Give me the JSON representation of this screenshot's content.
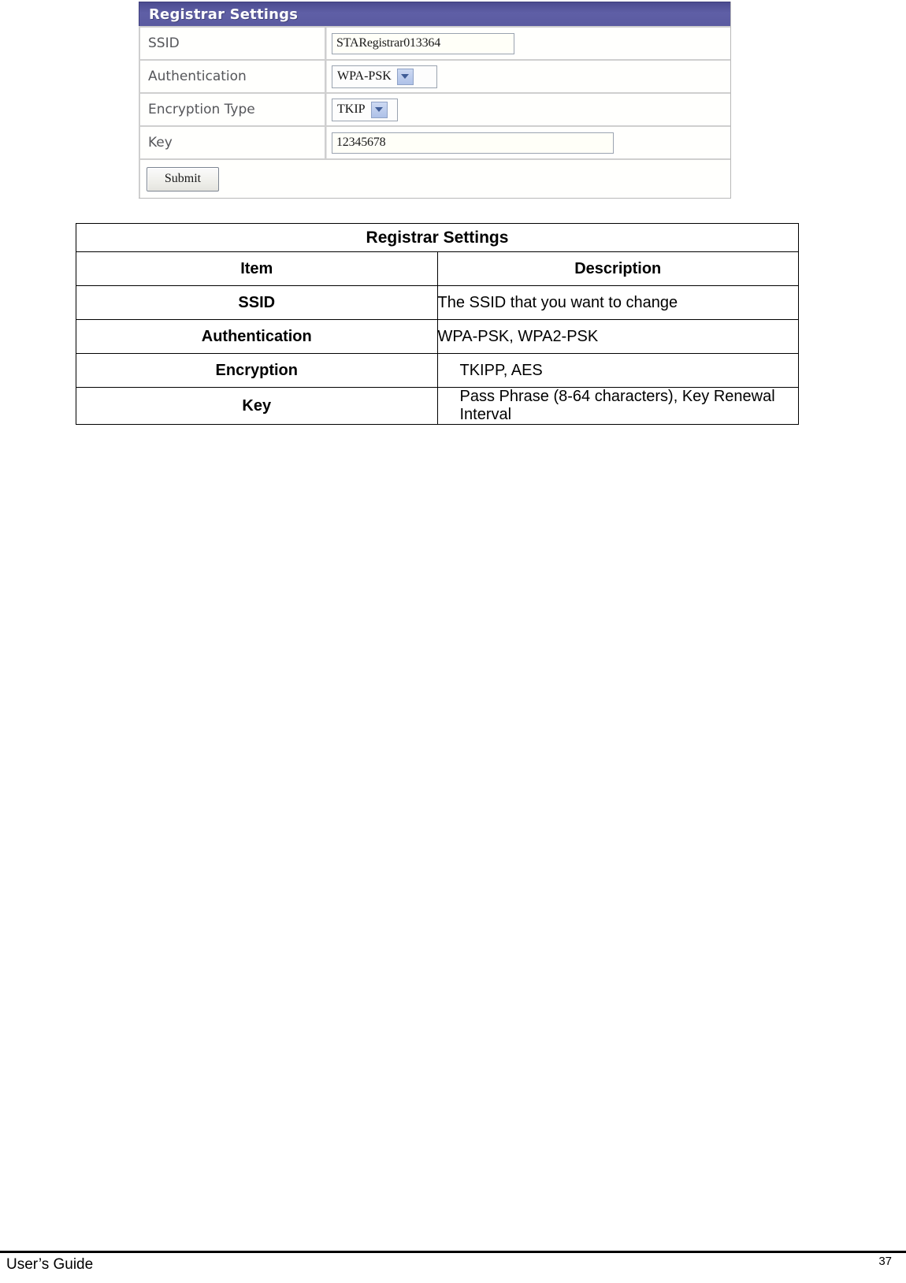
{
  "screenshot_panel": {
    "title": "Registrar Settings",
    "title_bar_color": "#5a5aa0",
    "rows": [
      {
        "label": "SSID",
        "control": "textbox",
        "value": "STARegistrar013364"
      },
      {
        "label": "Authentication",
        "control": "dropdown",
        "value": "WPA-PSK"
      },
      {
        "label": "Encryption Type",
        "control": "dropdown",
        "value": "TKIP"
      },
      {
        "label": "Key",
        "control": "textbox",
        "value": "12345678"
      }
    ],
    "submit_label": "Submit"
  },
  "description_table": {
    "title": "Registrar Settings",
    "headers": [
      "Item",
      "Description"
    ],
    "rows": [
      {
        "item": "SSID",
        "description": "The SSID that you want to change"
      },
      {
        "item": "Authentication",
        "description": "WPA-PSK, WPA2-PSK"
      },
      {
        "item": "Encryption",
        "description": "TKIPP, AES"
      },
      {
        "item": "Key",
        "description": "Pass Phrase (8-64 characters), Key Renewal Interval"
      }
    ]
  },
  "footer": {
    "document_name": "User’s Guide",
    "page_number": "37"
  }
}
